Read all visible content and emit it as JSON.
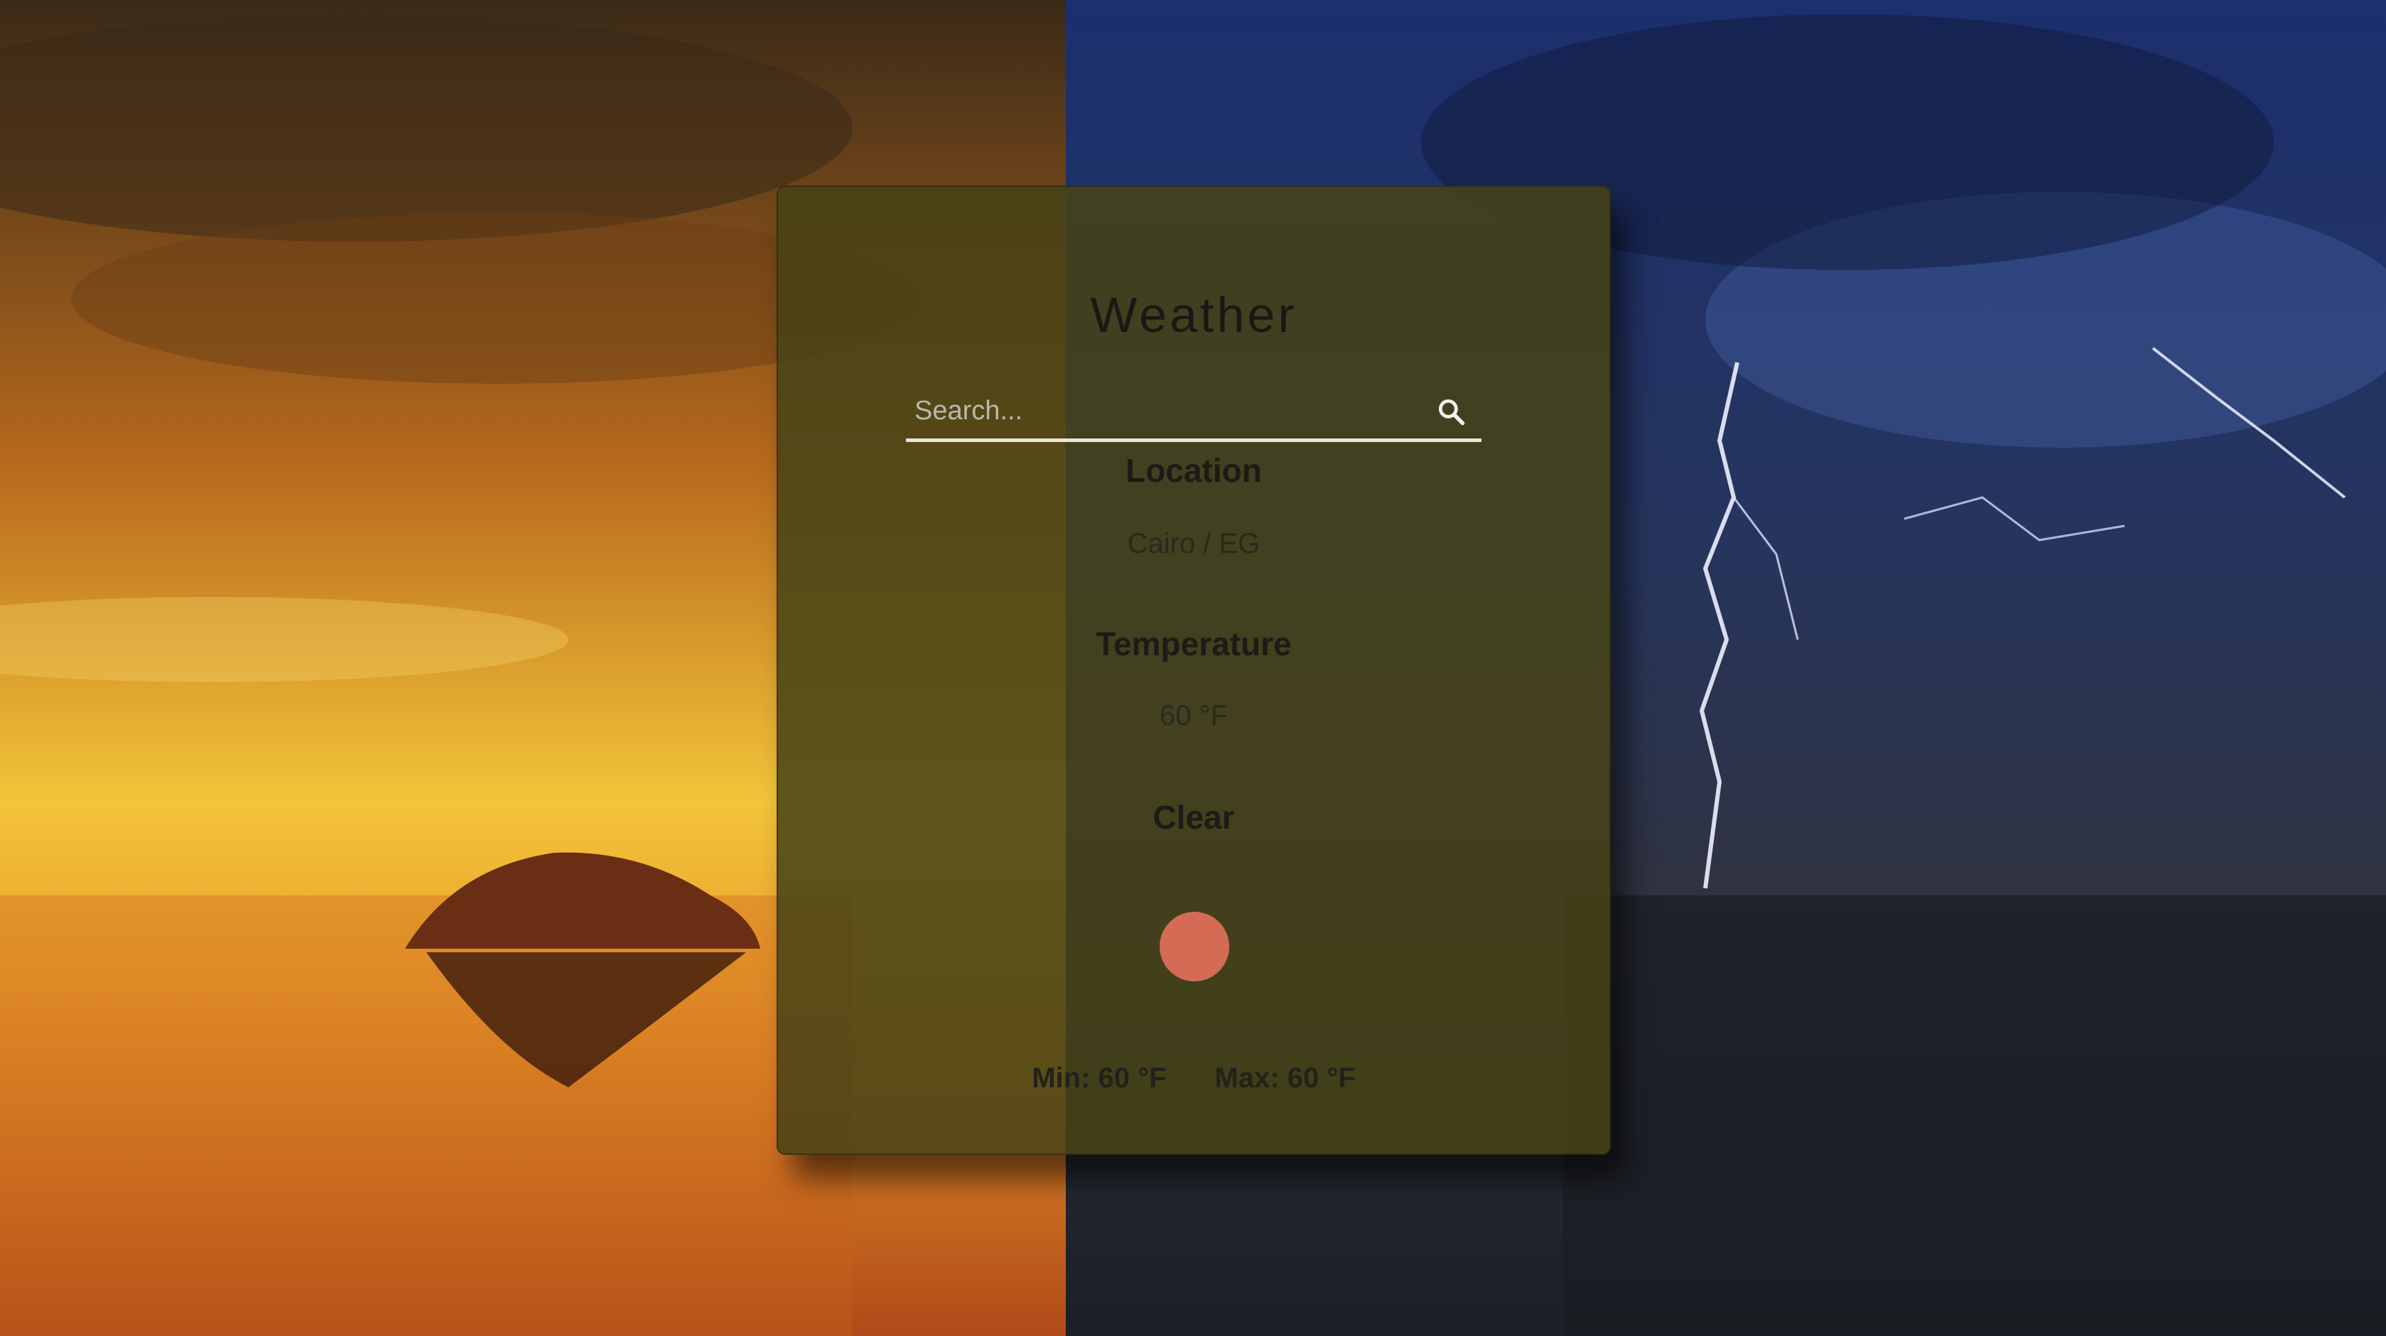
{
  "app": {
    "title": "Weather"
  },
  "search": {
    "placeholder": "Search...",
    "value": ""
  },
  "location": {
    "label": "Location",
    "value": "Cairo / EG"
  },
  "temperature": {
    "label": "Temperature",
    "value": "60 °F"
  },
  "condition": {
    "label": "Clear",
    "icon": "sun-circle-icon",
    "icon_color": "#d46b55"
  },
  "range": {
    "min_text": "Min: 60 °F",
    "max_text": "Max: 60 °F"
  },
  "colors": {
    "card_bg": "#46421a",
    "title": "#181814",
    "underline": "#e8e6dc"
  }
}
